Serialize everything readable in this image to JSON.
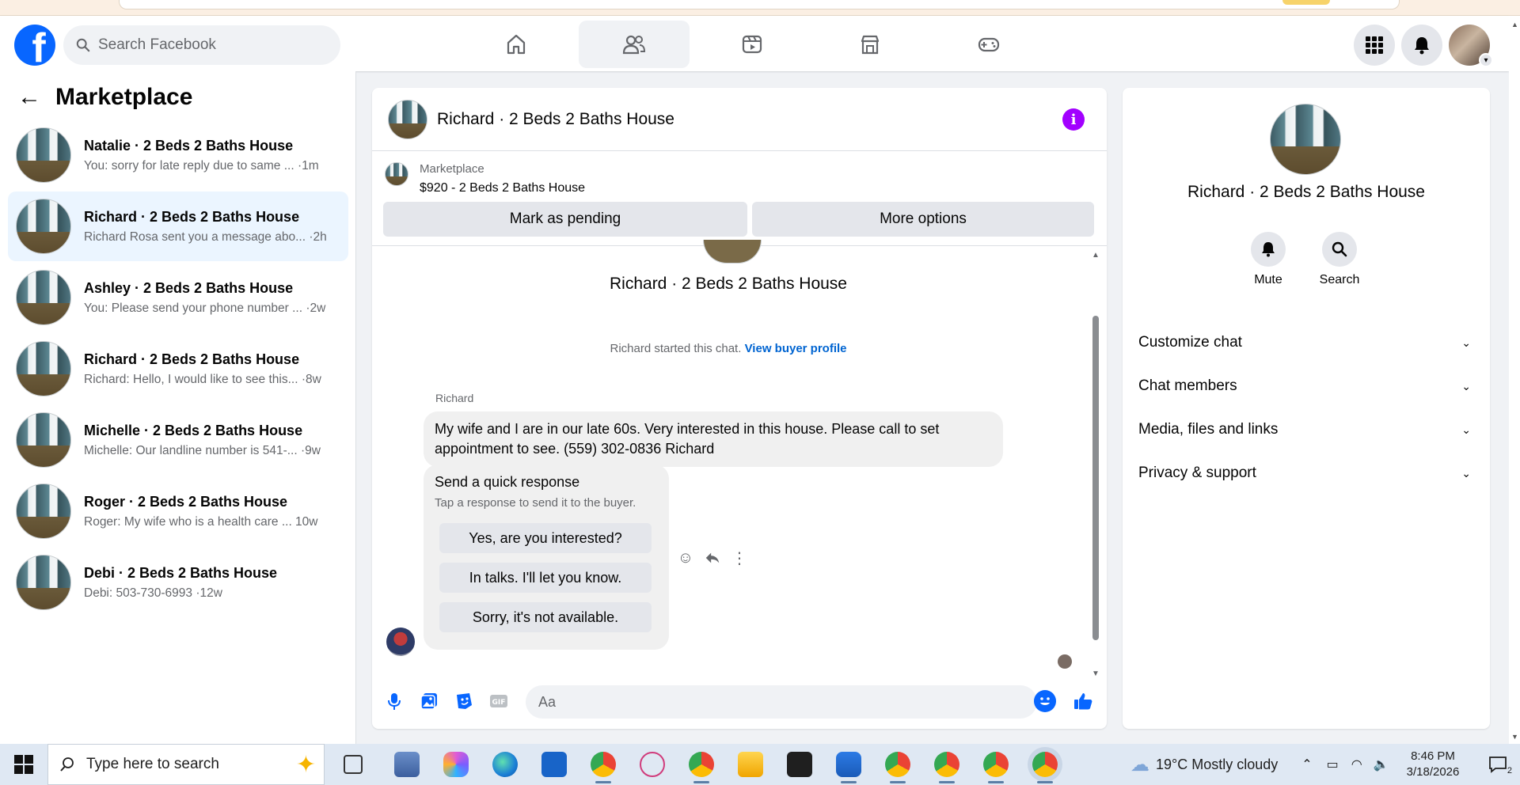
{
  "header": {
    "search_placeholder": "Search Facebook",
    "logo_letter": "f"
  },
  "sidebar": {
    "title": "Marketplace",
    "conversations": [
      {
        "name": "Natalie · 2 Beds 2 Baths House",
        "preview": "You: sorry for late reply due to same ... ·1m"
      },
      {
        "name": "Richard · 2 Beds 2 Baths House",
        "preview": "Richard Rosa sent you a message abo... ·2h"
      },
      {
        "name": "Ashley · 2 Beds 2 Baths House",
        "preview": "You: Please send your phone number ... ·2w"
      },
      {
        "name": "Richard · 2 Beds 2 Baths House",
        "preview": "Richard: Hello, I would like to see this... ·8w"
      },
      {
        "name": "Michelle · 2 Beds 2 Baths House",
        "preview": "Michelle: Our landline number is 541-... ·9w"
      },
      {
        "name": "Roger · 2 Beds 2 Baths House",
        "preview": "Roger: My wife who is a health care ... 10w"
      },
      {
        "name": "Debi · 2 Beds 2 Baths House",
        "preview": "Debi: 503-730-6993 ·12w"
      }
    ]
  },
  "chat": {
    "title": "Richard · 2 Beds 2 Baths House",
    "marketplace_label": "Marketplace",
    "listing_price": "$920 - 2 Beds 2 Baths House",
    "mark_pending": "Mark as pending",
    "more_options": "More options",
    "center_name": "Richard · 2 Beds 2 Baths House",
    "started_text": "Richard started this chat.",
    "view_profile": "View buyer profile",
    "sender": "Richard",
    "message": "My wife and I are in our late 60s. Very interested in this house. Please  call to set appointment to see. (559) 302-0836 Richard",
    "quick_title": "Send a quick response",
    "quick_sub": "Tap a response to send it to the buyer.",
    "quick_responses": [
      "Yes, are you interested?",
      "In talks. I'll let you know.",
      "Sorry, it's not available."
    ],
    "input_placeholder": "Aa"
  },
  "details": {
    "name": "Richard · 2 Beds 2 Baths House",
    "mute": "Mute",
    "search": "Search",
    "sections": [
      "Customize chat",
      "Chat members",
      "Media, files and links",
      "Privacy & support"
    ]
  },
  "taskbar": {
    "search_placeholder": "Type here to search",
    "weather": "19°C  Mostly cloudy",
    "time": "8:46 PM",
    "date": "3/18/2026",
    "notification_count": "2"
  },
  "colors": {
    "brand": "#0866ff",
    "info": "#a200ff",
    "link": "#0064d1"
  }
}
